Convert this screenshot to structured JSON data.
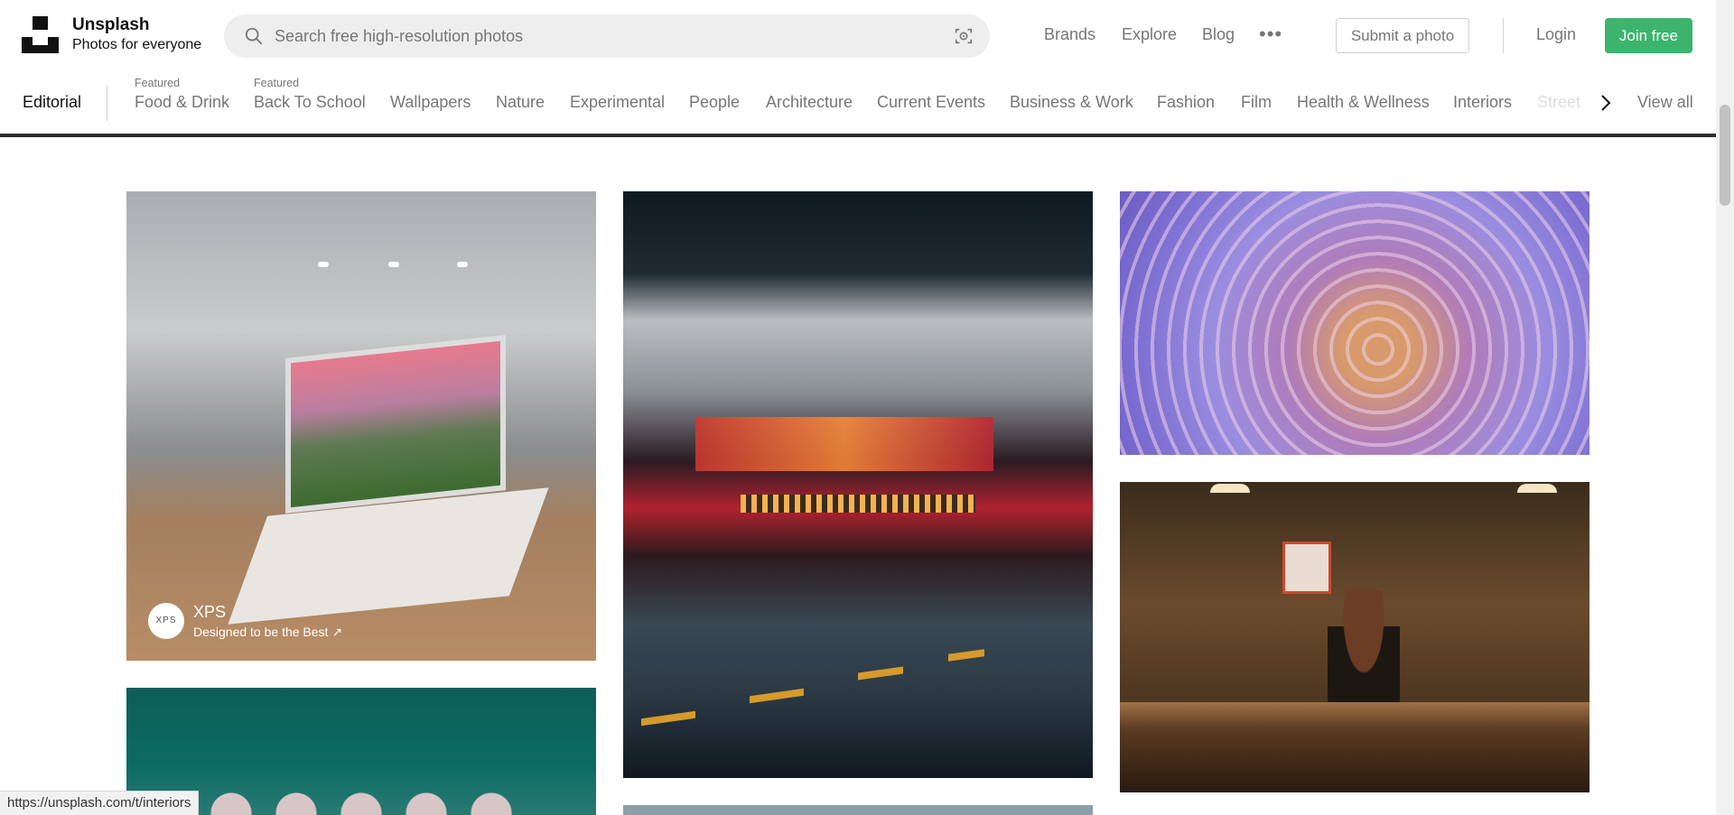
{
  "brand": {
    "name": "Unsplash",
    "tagline": "Photos for everyone"
  },
  "search": {
    "placeholder": "Search free high-resolution photos"
  },
  "nav": {
    "links": [
      "Brands",
      "Explore",
      "Blog"
    ],
    "more_icon": "ellipsis-icon",
    "submit_label": "Submit a photo",
    "login_label": "Login",
    "join_label": "Join free"
  },
  "topics": {
    "active": "Editorial",
    "featured_label": "Featured",
    "items": [
      {
        "label": "Food & Drink",
        "featured": true
      },
      {
        "label": "Back To School",
        "featured": true
      },
      {
        "label": "Wallpapers"
      },
      {
        "label": "Nature"
      },
      {
        "label": "Experimental"
      },
      {
        "label": "People"
      },
      {
        "label": "Architecture"
      },
      {
        "label": "Current Events"
      },
      {
        "label": "Business & Work"
      },
      {
        "label": "Fashion"
      },
      {
        "label": "Film"
      },
      {
        "label": "Health & Wellness"
      },
      {
        "label": "Interiors"
      },
      {
        "label": "Street"
      }
    ],
    "view_all": "View all"
  },
  "photos": {
    "sponsored": {
      "name": "XPS",
      "avatar_text": "XPS",
      "tagline": "Designed to be the Best ↗"
    }
  },
  "status_bar": {
    "url": "https://unsplash.com/t/interiors"
  },
  "colors": {
    "accent": "#3cb46e",
    "text": "#111111",
    "muted": "#767676"
  }
}
